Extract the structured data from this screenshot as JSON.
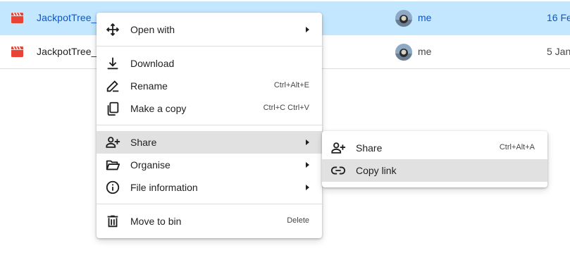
{
  "files": [
    {
      "name": "JackpotTree_",
      "owner": "me",
      "modified": "16 Fe",
      "selected": true
    },
    {
      "name": "JackpotTree_",
      "owner": "me",
      "modified": "5 Jan",
      "selected": false
    }
  ],
  "context_menu": {
    "open_with": "Open with",
    "download": "Download",
    "rename": "Rename",
    "rename_shortcut": "Ctrl+Alt+E",
    "make_copy": "Make a copy",
    "make_copy_shortcut": "Ctrl+C Ctrl+V",
    "share": "Share",
    "organise": "Organise",
    "file_information": "File information",
    "move_to_bin": "Move to bin",
    "move_to_bin_shortcut": "Delete"
  },
  "share_submenu": {
    "share": "Share",
    "share_shortcut": "Ctrl+Alt+A",
    "copy_link": "Copy link"
  },
  "colors": {
    "selected_row": "#c2e7ff",
    "selected_text": "#0b57d0",
    "menu_highlight": "#e1e1e1",
    "video_icon": "#ea4335"
  },
  "icons": {
    "file": "video-file-icon",
    "open_with": "move-arrows-icon",
    "download": "download-icon",
    "rename": "pencil-icon",
    "make_copy": "copy-icon",
    "share": "person-add-icon",
    "organise": "folder-open-icon",
    "file_information": "info-icon",
    "move_to_bin": "trash-icon",
    "copy_link": "link-icon"
  }
}
